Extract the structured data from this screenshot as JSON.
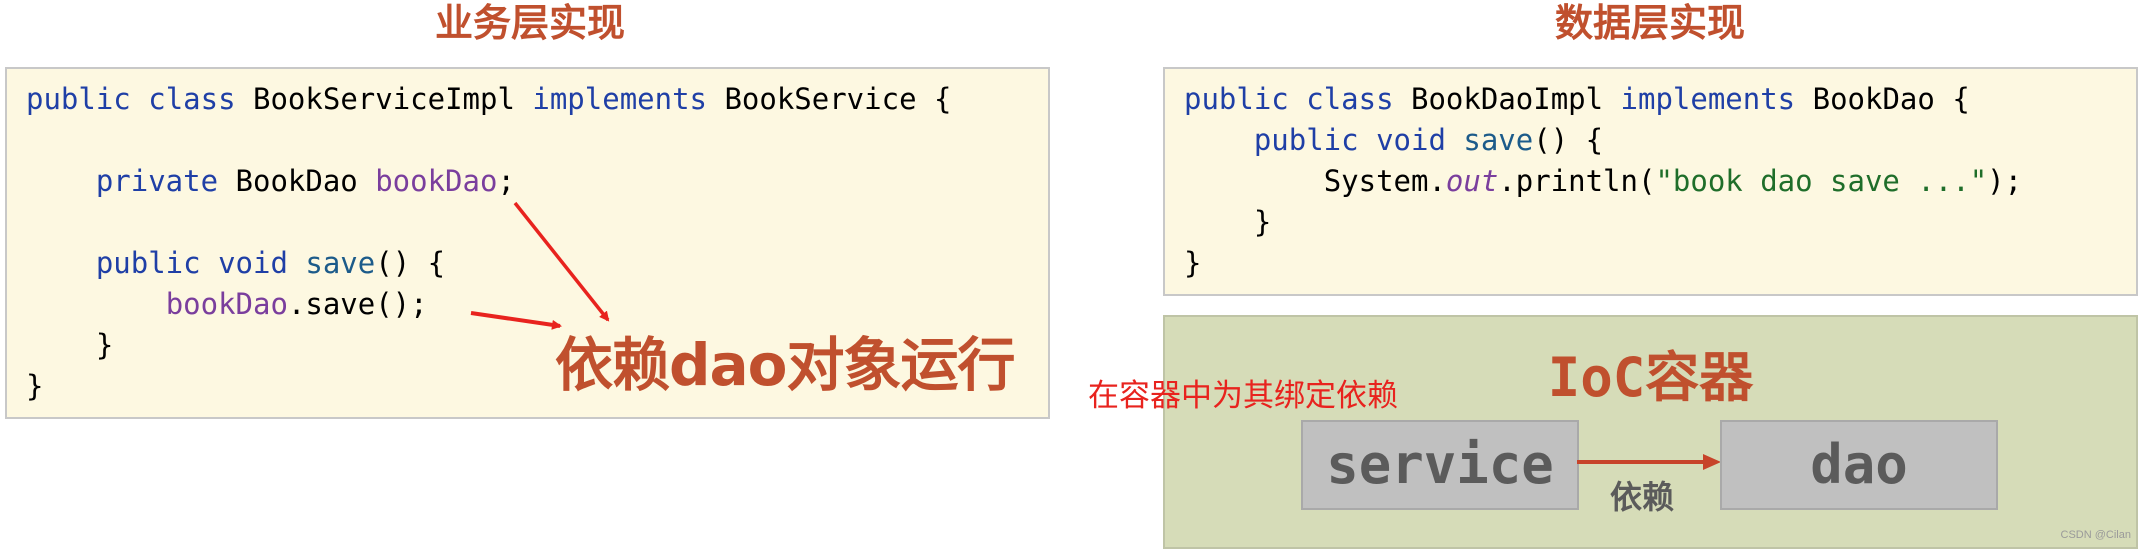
{
  "left_panel": {
    "title": "业务层实现",
    "code": {
      "l1": {
        "kw1": "public",
        "kw2": "class",
        "name": "BookServiceImpl",
        "kw3": "implements",
        "iface": "BookService",
        "brace": "{"
      },
      "l3": {
        "kw": "private",
        "type": "BookDao",
        "field": "bookDao",
        "semi": ";"
      },
      "l5": {
        "kw1": "public",
        "kw2": "void",
        "fn": "save",
        "rest": "() {"
      },
      "l6": {
        "field": "bookDao",
        "rest": ".save();"
      },
      "l7": {
        "brace": "}"
      },
      "l8": {
        "brace": "}"
      }
    },
    "annotation": "依赖dao对象运行"
  },
  "right_panel": {
    "title": "数据层实现",
    "code": {
      "l1": {
        "kw1": "public",
        "kw2": "class",
        "name": "BookDaoImpl",
        "kw3": "implements",
        "iface": "BookDao",
        "brace": "{"
      },
      "l2": {
        "kw1": "public",
        "kw2": "void",
        "fn": "save",
        "rest": "() {"
      },
      "l3": {
        "obj": "System.",
        "field": "out",
        "call": ".println(",
        "str": "\"book dao save ...\"",
        "end": ");"
      },
      "l4": {
        "brace": "}"
      },
      "l5": {
        "brace": "}"
      }
    }
  },
  "ioc": {
    "title": "IoC容器",
    "service_label": "service",
    "dao_label": "dao",
    "dependency_label": "依赖",
    "bind_note": "在容器中为其绑定依赖"
  },
  "colors": {
    "title": "#c0502e",
    "annotation_arrow": "#e8231e",
    "ioc_bg": "#d6dcb8",
    "code_bg": "#fdf8e1"
  },
  "watermark": "CSDN @Cilan"
}
